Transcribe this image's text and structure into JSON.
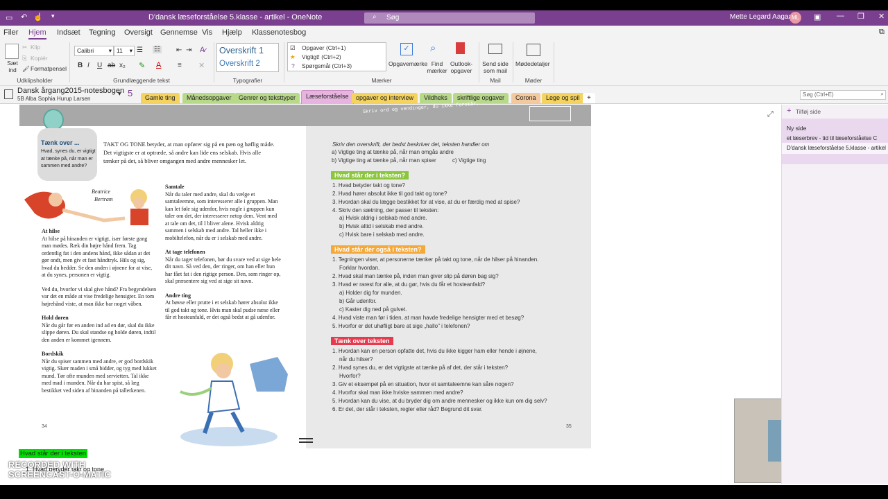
{
  "title": "D'dansk læseforståelse 5.klasse - artikel  -  OneNote",
  "search_placeholder": "Søg",
  "user": {
    "name": "Mette Legard Aagaard",
    "initials": "ML"
  },
  "menu": [
    "Filer",
    "Hjem",
    "Indsæt",
    "Tegning",
    "Oversigt",
    "Gennemse",
    "Vis",
    "Hjælp",
    "Klassenotesbog"
  ],
  "ribbon": {
    "clipboard": {
      "paste": "Sæt ind",
      "cut": "Klip",
      "copy": "Kopiér",
      "format_painter": "Formatpensel",
      "group": "Udklipsholder"
    },
    "font": {
      "family": "Calibri",
      "size": "11",
      "group": "Grundlæggende tekst"
    },
    "styles": {
      "h1": "Overskrift 1",
      "h2": "Overskrift 2",
      "group": "Typografier"
    },
    "tags": {
      "items": [
        "Opgaver (Ctrl+1)",
        "Vigtigt! (Ctrl+2)",
        "Spørgsmål (Ctrl+3)"
      ],
      "group": "Mærker"
    },
    "buttons": {
      "todo": "Opgavemærke",
      "find": "Find mærker",
      "outlook": "Outlook-opgaver",
      "send": "Send side som mail",
      "meeting": "Mødedetaljer"
    },
    "groups": {
      "mail": "Mail",
      "meetings": "Møder"
    }
  },
  "notebook": {
    "name": "Dansk årgang2015-notesbogen",
    "user": "5B Alba Sophia Hurup Larsen",
    "num": "5"
  },
  "sections": [
    {
      "label": "Gamle ting",
      "color": "#f4d35e"
    },
    {
      "label": "Månedsopgaver",
      "color": "#b8d98a"
    },
    {
      "label": "Genrer og teksttyper",
      "color": "#b8d98a"
    },
    {
      "label": "Læseforståelse",
      "color": "#e7b3df"
    },
    {
      "label": "opgaver og interview",
      "color": "#f4d35e"
    },
    {
      "label": "Vildheks",
      "color": "#b8d98a"
    },
    {
      "label": "skriftlige opgaver",
      "color": "#b8d98a"
    },
    {
      "label": "Corona",
      "color": "#f4c99e"
    },
    {
      "label": "Lege og spil",
      "color": "#f4d35e"
    }
  ],
  "page_search": "Søg (Ctrl+E)",
  "pages": {
    "add": "Tilføj side",
    "items": [
      "Ny side",
      "et læserbrev - tid til læseforståelse C",
      "D'dansk læseforståelse 5.klasse - artikel"
    ]
  },
  "left_page": {
    "think": {
      "title": "Tænk over ...",
      "text": "Hvad, synes du, er vigtigt at tænke på, når man er sammen med andre?"
    },
    "intro": "TAKT OG TONE betyder, at man opfører sig på en pæn og høflig måde. Det vigtigste er at optræde, så andre kan lide ens selskab. Hvis alle tænker på det, så bliver omgangen med andre mennesker let.",
    "names": [
      "Beatrice",
      "Bertram"
    ],
    "col1": [
      {
        "h": "At hilse",
        "t": "At hilse på hinanden er vigtigt, især første gang man mødes. Ræk din højre hånd frem. Tag ordentlig fat i den andens hånd, ikke sådan at det gør ondt, men giv et fast håndtryk. Hils og sig, hvad du hedder. Se den anden i øjnene for at vise, at du synes, personen er vigtig."
      },
      {
        "h": "",
        "t": "Ved du, hvorfor vi skal give hånd? Fra begyndelsen var det en måde at vise fredelige hensigter. En tom højrehånd viste, at man ikke bar noget våben."
      },
      {
        "h": "Hold døren",
        "t": "Når du går før en anden ind ad en dør, skal du ikke slippe døren. Du skal standse og holde døren, indtil den anden er kommet igennem."
      },
      {
        "h": "Bordskik",
        "t": "Når du spiser sammen med andre, er god bordskik vigtig. Skær maden i små bidder, og tyg med lukket mund. Tør ofte munden med servietten. Tal ikke med mad i munden. Når du har spist, så læg bestikket ved siden af hinanden på tallerkenen."
      }
    ],
    "col2": [
      {
        "h": "Samtale",
        "t": "Når du taler med andre, skal du vælge et samtaleemne, som interesserer alle i gruppen. Man kan let føle sig udenfor, hvis nogle i gruppen kun taler om det, der interesserer netop dem. Vent med at tale om det, til I bliver alene. Hvisk aldrig sammen i selskab med andre. Tal heller ikke i mobiltelefon, når du er i selskab med andre."
      },
      {
        "h": "At tage telefonen",
        "t": "Når du tager telefonen, bør du svare ved at sige hele dit navn. Så ved den, der ringer, om han eller hun har fået fat i den rigtige person. Den, som ringer op, skal præsentere sig ved at sige sit navn."
      },
      {
        "h": "Andre ting",
        "t": "At bøvse eller prutte i et selskab hører absolut ikke til god takt og tone. Hvis man skal pudse næse eller får et hosteanfald, er det også bedst at gå udenfor."
      }
    ],
    "page_num": "34"
  },
  "right_page": {
    "banner": "Skriv ord og vendinger, du ikke forstår...",
    "task": "Skriv den overskrift, der bedst beskriver det, teksten handler om",
    "options": [
      "a) Vigtige ting at tænke på, når man omgås andre",
      "b) Vigtige ting at tænke på, når man spiser",
      "c) Vigtige ting"
    ],
    "s1": {
      "title": "Hvad står der i teksten?",
      "items": [
        "1.  Hvad betyder takt og tone?",
        "2.  Hvad hører absolut ikke til god takt og tone?",
        "3.  Hvordan skal du lægge bestikket for at vise, at du er færdig med at spise?",
        "4.  Skriv den sætning, der passer til teksten:",
        "a)  Hvisk aldrig i selskab med andre.",
        "b)  Hvisk altid i selskab med andre.",
        "c)  Hvisk bare i selskab med andre."
      ]
    },
    "s2": {
      "title": "Hvad står der også i teksten?",
      "items": [
        "1.  Tegningen viser, at personerne tænker på takt og tone, når de hilser på hinanden.",
        "Forklar hvordan.",
        "2.  Hvad skal man tænke på, inden man giver slip på døren bag sig?",
        "3.  Hvad er rarest for alle, at du gør, hvis du får et hosteanfald?",
        "a)  Holder dig for munden.",
        "b)  Går udenfor.",
        "c)  Kaster dig ned på gulvet.",
        "4.  Hvad viste man før i tiden, at man havde fredelige hensigter med et besøg?",
        "5.  Hvorfor er det uhøfligt bare at sige „hallo\" i telefonen?"
      ]
    },
    "s3": {
      "title": "Tænk over teksten",
      "items": [
        "1.  Hvordan kan en person opfatte det, hvis du ikke kigger ham eller hende i øjnene,",
        "når du hilser?",
        "2.  Hvad synes du, er det vigtigste at tænke på af det, der står i teksten?",
        "Hvorfor?",
        "3.  Giv et eksempel på en situation, hvor et samtaleemne kan såre nogen?",
        "4.  Hvorfor skal man ikke hviske sammen med andre?",
        "5.  Hvordan kan du vise, at du bryder dig om andre mennesker og ikke kun om dig selv?",
        "6.  Er det, der står i teksten, regler eller råd? Begrund dit svar."
      ]
    },
    "page_num": "35"
  },
  "note": {
    "highlight": "Hvad står der i teksten",
    "line": "1.  Hvad betyder takt og tone"
  },
  "watermark": "RECORDED WITH SCREENCAST-O-MATIC"
}
